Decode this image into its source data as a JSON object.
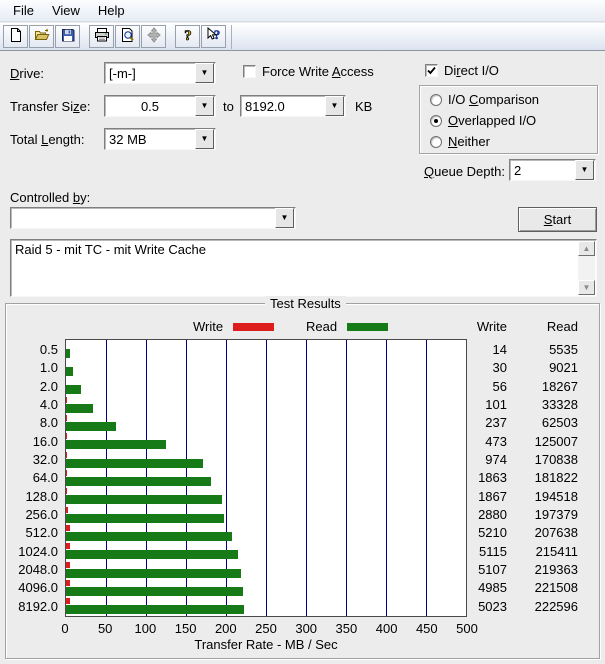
{
  "menu_bar": {
    "items": [
      "File",
      "View",
      "Help"
    ]
  },
  "toolbar": {
    "icons": [
      "new-document-icon",
      "open-file-icon",
      "save-icon",
      "print-icon",
      "print-preview-icon",
      "move-icon",
      "help-icon",
      "context-help-icon"
    ]
  },
  "form": {
    "drive": {
      "label": {
        "pre": "",
        "u": "D",
        "post": "rive:"
      },
      "value": "[-m-]"
    },
    "force_write_access": {
      "label": {
        "pre": "Force Write ",
        "u": "A",
        "post": "ccess"
      },
      "checked": false
    },
    "direct_io": {
      "label": {
        "pre": "Di",
        "u": "r",
        "post": "ect I/O"
      },
      "checked": true
    },
    "transfer_size": {
      "label": {
        "pre": "Transfer Si",
        "u": "z",
        "post": "e:"
      },
      "from": "0.5",
      "to_word": "to",
      "to": "8192.0",
      "unit": "KB"
    },
    "total_length": {
      "label": {
        "pre": "Total ",
        "u": "L",
        "post": "ength:"
      },
      "value": "32 MB"
    },
    "io_mode": {
      "options": [
        {
          "label": {
            "pre": "I/O ",
            "u": "C",
            "post": "omparison"
          },
          "selected": false
        },
        {
          "label": {
            "pre": "",
            "u": "O",
            "post": "verlapped I/O"
          },
          "selected": true
        },
        {
          "label": {
            "pre": "",
            "u": "N",
            "post": "either"
          },
          "selected": false
        }
      ]
    },
    "queue_depth": {
      "label": {
        "pre": "",
        "u": "Q",
        "post": "ueue Depth:"
      },
      "value": "2"
    },
    "controlled_by": {
      "label": {
        "pre": "Controlled ",
        "u": "b",
        "post": "y:"
      },
      "value": ""
    },
    "start_button": {
      "label": {
        "pre": "",
        "u": "S",
        "post": "tart"
      }
    },
    "description": "Raid 5 - mit TC - mit Write Cache"
  },
  "chart_data": {
    "type": "bar",
    "orientation": "horizontal",
    "title": "Test Results",
    "categories": [
      "0.5",
      "1.0",
      "2.0",
      "4.0",
      "8.0",
      "16.0",
      "32.0",
      "64.0",
      "128.0",
      "256.0",
      "512.0",
      "1024.0",
      "2048.0",
      "4096.0",
      "8192.0"
    ],
    "series": [
      {
        "name": "Write",
        "color": "#dd1c1c",
        "values": [
          14,
          30,
          56,
          101,
          237,
          473,
          974,
          1863,
          1867,
          2880,
          5210,
          5115,
          5107,
          4985,
          5023
        ]
      },
      {
        "name": "Read",
        "color": "#167a16",
        "values": [
          5535,
          9021,
          18267,
          33328,
          62503,
          125007,
          170838,
          181822,
          194518,
          197379,
          207638,
          215411,
          219363,
          221508,
          222596
        ]
      }
    ],
    "bar_scale_divisor": 1000,
    "xlabel": "Transfer Rate - MB / Sec",
    "xticks": [
      0,
      50,
      100,
      150,
      200,
      250,
      300,
      350,
      400,
      450,
      500
    ],
    "xlim": [
      0,
      500
    ],
    "grid": "vertical",
    "legend_position": "top"
  }
}
